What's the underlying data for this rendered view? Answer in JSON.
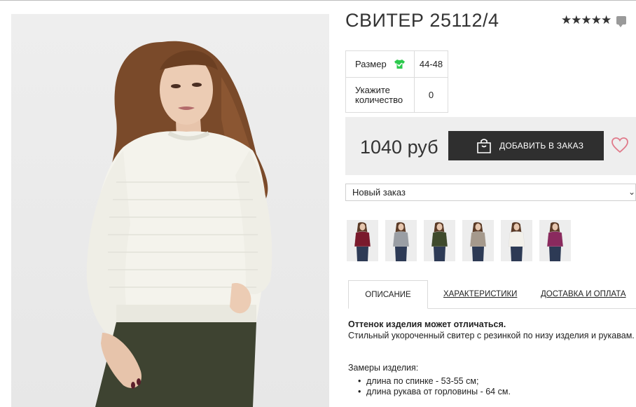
{
  "product": {
    "title": "СВИТЕР 25112/4",
    "rating_stars": 5
  },
  "options": {
    "size_label": "Размер",
    "size_value": "44-48",
    "qty_label": "Укажите количество",
    "qty_value": "0"
  },
  "buy": {
    "price": "1040 руб",
    "add_label": "ДОБАВИТЬ В ЗАКАЗ"
  },
  "order_select": {
    "selected": "Новый заказ"
  },
  "colors": {
    "accent_dark": "#2f2f2f",
    "heart": "#e07a8a",
    "panel_bg": "#eeeeee",
    "size_check": "#2cc94d"
  },
  "thumbnails": [
    {
      "sweater": "#7a1a2c"
    },
    {
      "sweater": "#9a9ea4"
    },
    {
      "sweater": "#3f4a2c"
    },
    {
      "sweater": "#a5998c"
    },
    {
      "sweater": "#f2f0ea"
    },
    {
      "sweater": "#8a2a5e"
    }
  ],
  "tabs": [
    {
      "label": "ОПИСАНИЕ"
    },
    {
      "label": "ХАРАКТЕРИСТИКИ"
    },
    {
      "label": "ДОСТАВКА И ОПЛАТА"
    }
  ],
  "description": {
    "note": "Оттенок изделия может отличаться.",
    "text": "Стильный укороченный свитер с резинкой по низу изделия и рукавам.",
    "measures_title": "Замеры изделия:",
    "measures": [
      "длина по спинке - 53-55 см;",
      "длина рукава от горловины - 64 см."
    ]
  }
}
